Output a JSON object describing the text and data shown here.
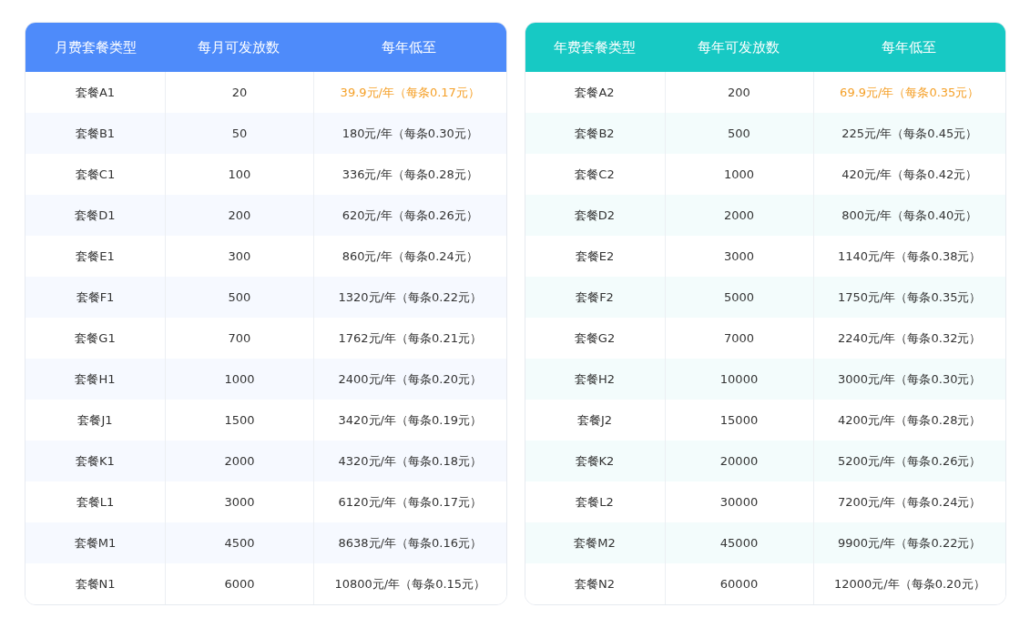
{
  "tables": [
    {
      "color": "#4e8bfa",
      "columns": [
        "月费套餐类型",
        "每月可发放数",
        "每年低至"
      ],
      "rows": [
        {
          "cells": [
            "套餐A1",
            "20",
            "39.9元/年（每条0.17元）"
          ],
          "highlighted": true
        },
        {
          "cells": [
            "套餐B1",
            "50",
            "180元/年（每条0.30元）"
          ],
          "highlighted": false
        },
        {
          "cells": [
            "套餐C1",
            "100",
            "336元/年（每条0.28元）"
          ],
          "highlighted": false
        },
        {
          "cells": [
            "套餐D1",
            "200",
            "620元/年（每条0.26元）"
          ],
          "highlighted": false
        },
        {
          "cells": [
            "套餐E1",
            "300",
            "860元/年（每条0.24元）"
          ],
          "highlighted": false
        },
        {
          "cells": [
            "套餐F1",
            "500",
            "1320元/年（每条0.22元）"
          ],
          "highlighted": false
        },
        {
          "cells": [
            "套餐G1",
            "700",
            "1762元/年（每条0.21元）"
          ],
          "highlighted": false
        },
        {
          "cells": [
            "套餐H1",
            "1000",
            "2400元/年（每条0.20元）"
          ],
          "highlighted": false
        },
        {
          "cells": [
            "套餐J1",
            "1500",
            "3420元/年（每条0.19元）"
          ],
          "highlighted": false
        },
        {
          "cells": [
            "套餐K1",
            "2000",
            "4320元/年（每条0.18元）"
          ],
          "highlighted": false
        },
        {
          "cells": [
            "套餐L1",
            "3000",
            "6120元/年（每条0.17元）"
          ],
          "highlighted": false
        },
        {
          "cells": [
            "套餐M1",
            "4500",
            "8638元/年（每条0.16元）"
          ],
          "highlighted": false
        },
        {
          "cells": [
            "套餐N1",
            "6000",
            "10800元/年（每条0.15元）"
          ],
          "highlighted": false
        }
      ]
    },
    {
      "color": "#17c9c4",
      "columns": [
        "年费套餐类型",
        "每年可发放数",
        "每年低至"
      ],
      "rows": [
        {
          "cells": [
            "套餐A2",
            "200",
            "69.9元/年（每条0.35元）"
          ],
          "highlighted": true
        },
        {
          "cells": [
            "套餐B2",
            "500",
            "225元/年（每条0.45元）"
          ],
          "highlighted": false
        },
        {
          "cells": [
            "套餐C2",
            "1000",
            "420元/年（每条0.42元）"
          ],
          "highlighted": false
        },
        {
          "cells": [
            "套餐D2",
            "2000",
            "800元/年（每条0.40元）"
          ],
          "highlighted": false
        },
        {
          "cells": [
            "套餐E2",
            "3000",
            "1140元/年（每条0.38元）"
          ],
          "highlighted": false
        },
        {
          "cells": [
            "套餐F2",
            "5000",
            "1750元/年（每条0.35元）"
          ],
          "highlighted": false
        },
        {
          "cells": [
            "套餐G2",
            "7000",
            "2240元/年（每条0.32元）"
          ],
          "highlighted": false
        },
        {
          "cells": [
            "套餐H2",
            "10000",
            "3000元/年（每条0.30元）"
          ],
          "highlighted": false
        },
        {
          "cells": [
            "套餐J2",
            "15000",
            "4200元/年（每条0.28元）"
          ],
          "highlighted": false
        },
        {
          "cells": [
            "套餐K2",
            "20000",
            "5200元/年（每条0.26元）"
          ],
          "highlighted": false
        },
        {
          "cells": [
            "套餐L2",
            "30000",
            "7200元/年（每条0.24元）"
          ],
          "highlighted": false
        },
        {
          "cells": [
            "套餐M2",
            "45000",
            "9900元/年（每条0.22元）"
          ],
          "highlighted": false
        },
        {
          "cells": [
            "套餐N2",
            "60000",
            "12000元/年（每条0.20元）"
          ],
          "highlighted": false
        }
      ]
    }
  ]
}
